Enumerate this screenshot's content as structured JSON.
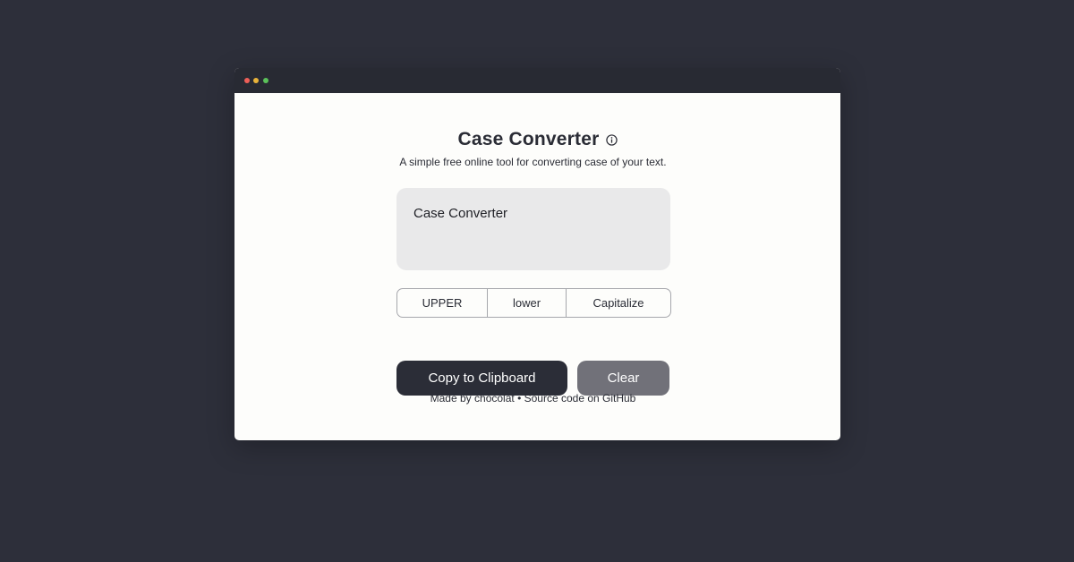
{
  "app": {
    "title": "Case Converter",
    "subtitle": "A simple free online tool for converting case of your text."
  },
  "input": {
    "value": "Case Converter"
  },
  "case_buttons": [
    {
      "label": "UPPER"
    },
    {
      "label": "lower"
    },
    {
      "label": "Capitalize"
    }
  ],
  "actions": {
    "copy_label": "Copy to Clipboard",
    "clear_label": "Clear"
  },
  "footer": {
    "made_by_prefix": "Made by",
    "author": "chocolat",
    "separator": "•",
    "source_link": "Source code on GitHub"
  },
  "icons": {
    "title_info": "info-icon"
  },
  "colors": {
    "page_bg": "#2d2f3a",
    "titlebar_bg": "#282a33",
    "window_bg": "#fdfdfb",
    "primary_button": "#2b2d37",
    "secondary_button": "#717179",
    "input_bg": "#e9e9ea"
  }
}
